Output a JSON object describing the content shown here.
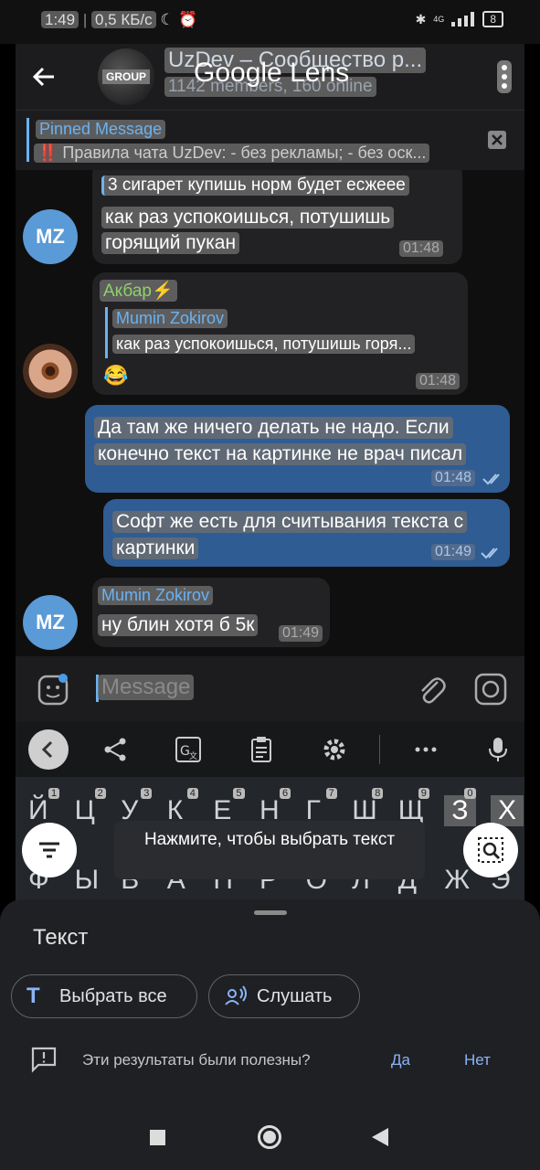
{
  "status": {
    "time": "1:49",
    "speed": "0,5 КБ/с",
    "network": "4G",
    "battery": "8"
  },
  "header": {
    "title": "UzDev – Сообщество р...",
    "subtitle": "1142 members, 160 online",
    "avatar_label": "GROUP",
    "overlay_title": "Google Lens"
  },
  "pinned": {
    "label": "Pinned Message",
    "text": "‼️ Правила чата UzDev: - без рекламы; - без оск..."
  },
  "messages": {
    "m1": {
      "lines": [
        "3 сигарет купишь норм будет есжеее",
        "как раз успокоишься, потушишь",
        "горящий пукан"
      ],
      "time": "01:48",
      "avatar": "MZ"
    },
    "m2": {
      "sender": "Акбар⚡",
      "reply_author": "Mumin Zokirov",
      "reply_text": "как раз успокоишься, потушишь горя...",
      "text": "😂",
      "time": "01:48"
    },
    "m3": {
      "lines": [
        "Да там же ничего делать не надо. Если",
        "конечно текст на картинке не врач писал"
      ],
      "time": "01:48"
    },
    "m4": {
      "lines": [
        "Софт же есть для считывания текста с",
        "картинки"
      ],
      "time": "01:49"
    },
    "m5": {
      "sender": "Mumin Zokirov",
      "text": "ну блин хотя б 5к",
      "time": "01:49",
      "avatar": "MZ"
    }
  },
  "input": {
    "placeholder": "Message"
  },
  "keyboard": {
    "row1": [
      "Й",
      "Ц",
      "У",
      "К",
      "Е",
      "Н",
      "Г",
      "Ш",
      "Щ",
      "З",
      "Х"
    ],
    "row1_nums": [
      "1",
      "2",
      "3",
      "4",
      "5",
      "6",
      "7",
      "8",
      "9",
      "0"
    ],
    "row2": [
      "Ф",
      "Ы",
      "В",
      "А",
      "П",
      "Р",
      "О",
      "Л",
      "Д",
      "Ж",
      "Э"
    ]
  },
  "lens": {
    "hint": "Нажмите, чтобы выбрать текст"
  },
  "sheet": {
    "title": "Текст",
    "select_all": "Выбрать все",
    "listen": "Слушать",
    "feedback_question": "Эти результаты были полезны?",
    "yes": "Да",
    "no": "Нет"
  },
  "colors": {
    "accent": "#6ab2f2",
    "outgoing_bubble": "#2f5c93",
    "link": "#8ab4f8"
  }
}
